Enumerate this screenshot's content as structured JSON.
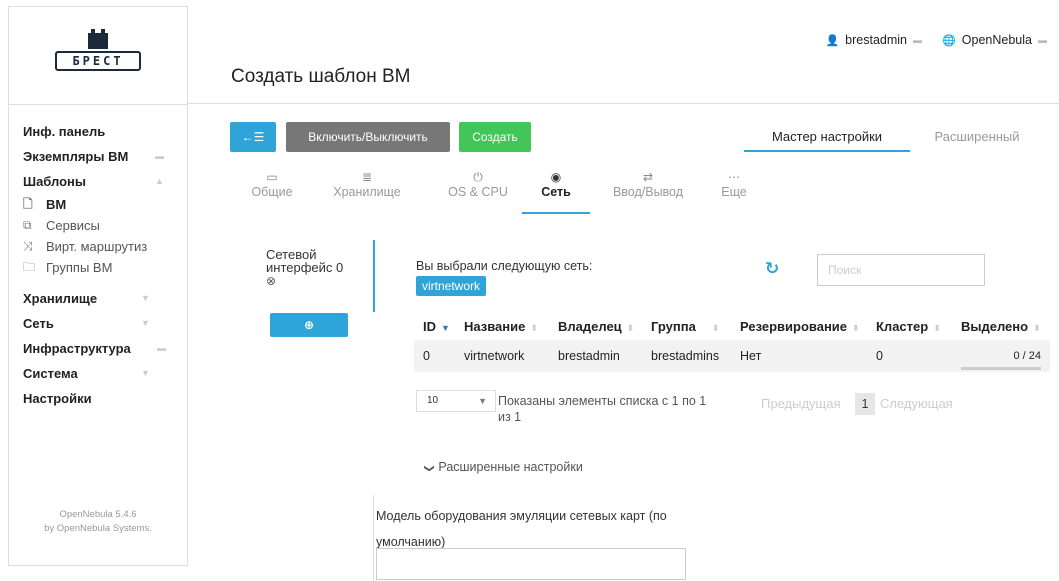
{
  "header": {
    "page_title": "Создать шаблон ВМ",
    "user": "brestadmin",
    "zone": "OpenNebula"
  },
  "logo": {
    "text": "БРЕСТ"
  },
  "sidebar": {
    "items": [
      {
        "label": "Инф. панель"
      },
      {
        "label": "Экземпляры ВМ"
      },
      {
        "label": "Шаблоны"
      },
      {
        "label": "Хранилище"
      },
      {
        "label": "Сеть"
      },
      {
        "label": "Инфраструктура"
      },
      {
        "label": "Система"
      },
      {
        "label": "Настройки"
      }
    ],
    "templates_sub": [
      {
        "label": "ВМ",
        "icon": "file-icon"
      },
      {
        "label": "Сервисы",
        "icon": "copy-icon"
      },
      {
        "label": "Вирт. маршрутиз",
        "icon": "shuffle-icon"
      },
      {
        "label": "Группы ВМ",
        "icon": "folder-icon"
      }
    ],
    "version_line1": "OpenNebula 5.4.6",
    "version_line2": "by OpenNebula Systems."
  },
  "toolbar": {
    "toggle_label": "Включить/Выключить",
    "create_label": "Создать",
    "wizard_tab": "Мастер настройки",
    "advanced_tab": "Расширенный"
  },
  "section_tabs": [
    {
      "label": "Общие",
      "icon": "monitor-icon"
    },
    {
      "label": "Хранилище",
      "icon": "storage-icon"
    },
    {
      "label": "OS & CPU",
      "icon": "power-icon"
    },
    {
      "label": "Сеть",
      "icon": "globe-icon"
    },
    {
      "label": "Ввод/Вывод",
      "icon": "exchange-icon"
    },
    {
      "label": "Еще",
      "icon": "ellipsis-icon"
    }
  ],
  "nic": {
    "title": "Сетевой интерфейс 0"
  },
  "network": {
    "selected_label": "Вы выбрали следующую сеть:",
    "selected_value": "virtnetwork",
    "search_placeholder": "Поиск"
  },
  "table": {
    "columns": [
      "ID",
      "Название",
      "Владелец",
      "Группа",
      "Резервирование",
      "Кластер",
      "Выделено"
    ],
    "rows": [
      {
        "id": "0",
        "name": "virtnetwork",
        "owner": "brestadmin",
        "group": "brestadmins",
        "reservation": "Нет",
        "cluster": "0",
        "allocated": "0 / 24",
        "allocated_fraction": 0
      }
    ]
  },
  "pager": {
    "page_size": "10",
    "info": "Показаны элементы списка с 1 по 1 из 1",
    "prev": "Предыдущая",
    "page": "1",
    "next": "Следующая"
  },
  "advanced": {
    "label": "Расширенные настройки"
  },
  "model": {
    "label": "Модель оборудования эмуляции сетевых карт (по умолчанию)",
    "value": ""
  }
}
